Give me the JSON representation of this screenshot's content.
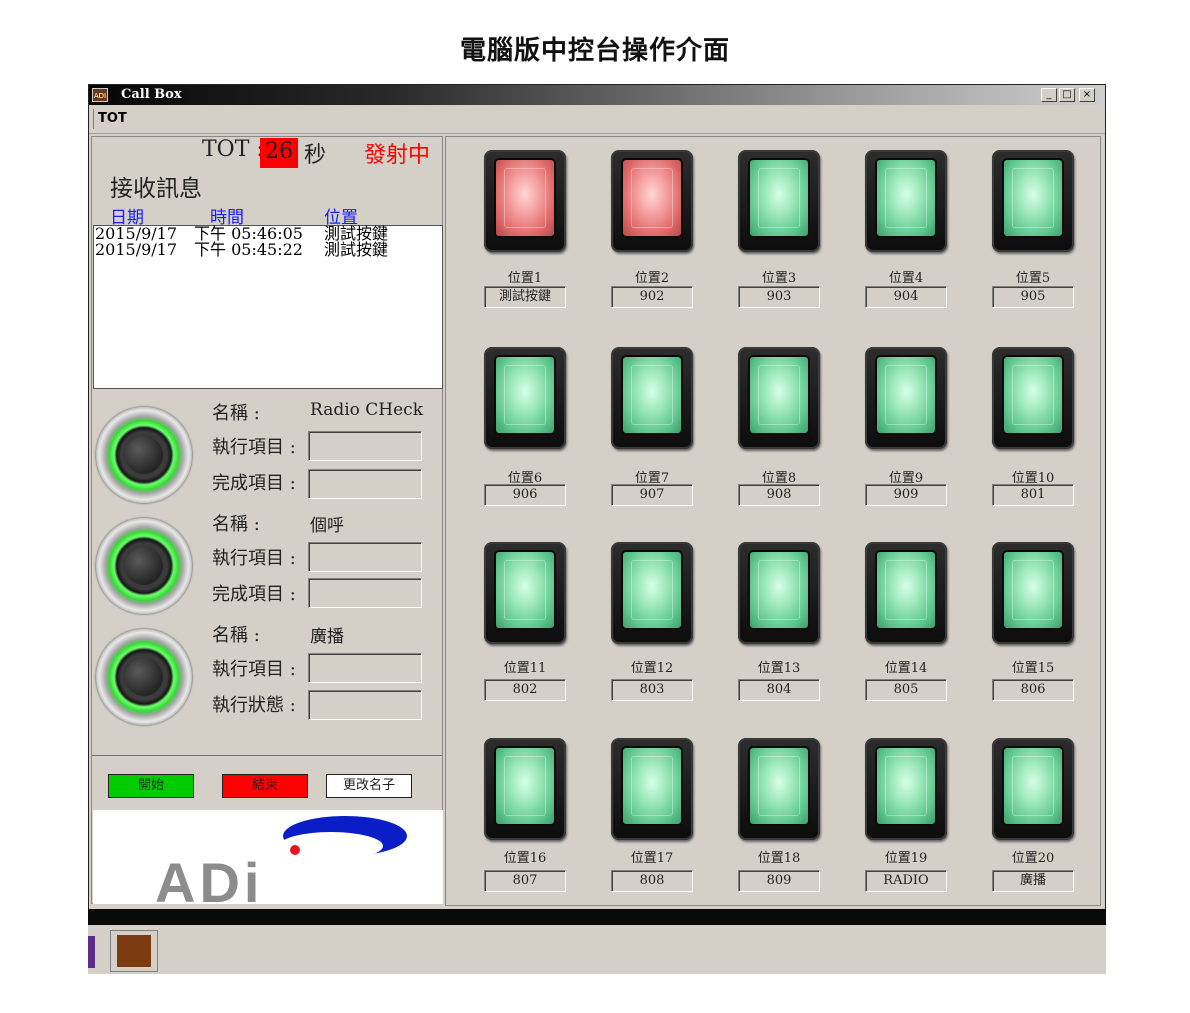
{
  "page_title": "電腦版中控台操作介面",
  "window": {
    "title": "Call Box",
    "app_icon_text": "ADI",
    "controls": {
      "minimize": "_",
      "maximize": "□",
      "close": "×"
    },
    "menu": [
      "TOT"
    ]
  },
  "left": {
    "tot_label": "TOT :",
    "tot_value": "26",
    "tot_unit": "秒",
    "tx_status": "發射中",
    "recv_title": "接收訊息",
    "columns": [
      "日期",
      "時間",
      "位置"
    ],
    "log": [
      {
        "date": "2015/9/17",
        "time": "下午 05:46:05",
        "location": "測試按鍵"
      },
      {
        "date": "2015/9/17",
        "time": "下午 05:45:22",
        "location": "測試按鍵"
      }
    ],
    "tasks": [
      {
        "name_label": "名稱 :",
        "name": "Radio CHeck",
        "field1_label": "執行項目 :",
        "field2_label": "完成項目 :"
      },
      {
        "name_label": "名稱 :",
        "name": "個呼",
        "field1_label": "執行項目 :",
        "field2_label": "完成項目 :"
      },
      {
        "name_label": "名稱 :",
        "name": "廣播",
        "field1_label": "執行項目 :",
        "field2_label": "執行狀態 :"
      }
    ],
    "buttons": {
      "start": "開始",
      "end": "結束",
      "rename": "更改名子"
    },
    "logo_text": "ADi",
    "colors": {
      "start": "#00cc00",
      "end": "#ff0000",
      "tot_bg": "#ff0000",
      "status": "#ff0000",
      "header": "#1a1aff"
    }
  },
  "positions": [
    {
      "label": "位置1",
      "value": "測試按鍵",
      "state": "red"
    },
    {
      "label": "位置2",
      "value": "902",
      "state": "red"
    },
    {
      "label": "位置3",
      "value": "903",
      "state": "green"
    },
    {
      "label": "位置4",
      "value": "904",
      "state": "green"
    },
    {
      "label": "位置5",
      "value": "905",
      "state": "green"
    },
    {
      "label": "位置6",
      "value": "906",
      "state": "green"
    },
    {
      "label": "位置7",
      "value": "907",
      "state": "green"
    },
    {
      "label": "位置8",
      "value": "908",
      "state": "green"
    },
    {
      "label": "位置9",
      "value": "909",
      "state": "green"
    },
    {
      "label": "位置10",
      "value": "801",
      "state": "green"
    },
    {
      "label": "位置11",
      "value": "802",
      "state": "green"
    },
    {
      "label": "位置12",
      "value": "803",
      "state": "green"
    },
    {
      "label": "位置13",
      "value": "804",
      "state": "green"
    },
    {
      "label": "位置14",
      "value": "805",
      "state": "green"
    },
    {
      "label": "位置15",
      "value": "806",
      "state": "green"
    },
    {
      "label": "位置16",
      "value": "807",
      "state": "green"
    },
    {
      "label": "位置17",
      "value": "808",
      "state": "green"
    },
    {
      "label": "位置18",
      "value": "809",
      "state": "green"
    },
    {
      "label": "位置19",
      "value": "RADIO",
      "state": "green"
    },
    {
      "label": "位置20",
      "value": "廣播",
      "state": "green"
    }
  ],
  "taskbar": {
    "app_icon": "adi-app-icon"
  }
}
